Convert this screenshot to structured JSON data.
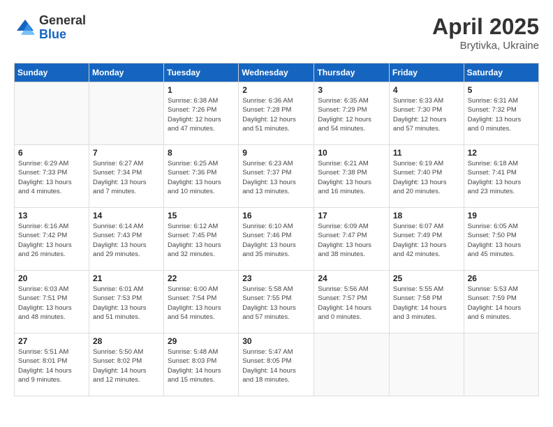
{
  "header": {
    "logo_general": "General",
    "logo_blue": "Blue",
    "title": "April 2025",
    "subtitle": "Brytivka, Ukraine"
  },
  "days_of_week": [
    "Sunday",
    "Monday",
    "Tuesday",
    "Wednesday",
    "Thursday",
    "Friday",
    "Saturday"
  ],
  "weeks": [
    [
      {
        "day": "",
        "info": ""
      },
      {
        "day": "",
        "info": ""
      },
      {
        "day": "1",
        "info": "Sunrise: 6:38 AM\nSunset: 7:26 PM\nDaylight: 12 hours\nand 47 minutes."
      },
      {
        "day": "2",
        "info": "Sunrise: 6:36 AM\nSunset: 7:28 PM\nDaylight: 12 hours\nand 51 minutes."
      },
      {
        "day": "3",
        "info": "Sunrise: 6:35 AM\nSunset: 7:29 PM\nDaylight: 12 hours\nand 54 minutes."
      },
      {
        "day": "4",
        "info": "Sunrise: 6:33 AM\nSunset: 7:30 PM\nDaylight: 12 hours\nand 57 minutes."
      },
      {
        "day": "5",
        "info": "Sunrise: 6:31 AM\nSunset: 7:32 PM\nDaylight: 13 hours\nand 0 minutes."
      }
    ],
    [
      {
        "day": "6",
        "info": "Sunrise: 6:29 AM\nSunset: 7:33 PM\nDaylight: 13 hours\nand 4 minutes."
      },
      {
        "day": "7",
        "info": "Sunrise: 6:27 AM\nSunset: 7:34 PM\nDaylight: 13 hours\nand 7 minutes."
      },
      {
        "day": "8",
        "info": "Sunrise: 6:25 AM\nSunset: 7:36 PM\nDaylight: 13 hours\nand 10 minutes."
      },
      {
        "day": "9",
        "info": "Sunrise: 6:23 AM\nSunset: 7:37 PM\nDaylight: 13 hours\nand 13 minutes."
      },
      {
        "day": "10",
        "info": "Sunrise: 6:21 AM\nSunset: 7:38 PM\nDaylight: 13 hours\nand 16 minutes."
      },
      {
        "day": "11",
        "info": "Sunrise: 6:19 AM\nSunset: 7:40 PM\nDaylight: 13 hours\nand 20 minutes."
      },
      {
        "day": "12",
        "info": "Sunrise: 6:18 AM\nSunset: 7:41 PM\nDaylight: 13 hours\nand 23 minutes."
      }
    ],
    [
      {
        "day": "13",
        "info": "Sunrise: 6:16 AM\nSunset: 7:42 PM\nDaylight: 13 hours\nand 26 minutes."
      },
      {
        "day": "14",
        "info": "Sunrise: 6:14 AM\nSunset: 7:43 PM\nDaylight: 13 hours\nand 29 minutes."
      },
      {
        "day": "15",
        "info": "Sunrise: 6:12 AM\nSunset: 7:45 PM\nDaylight: 13 hours\nand 32 minutes."
      },
      {
        "day": "16",
        "info": "Sunrise: 6:10 AM\nSunset: 7:46 PM\nDaylight: 13 hours\nand 35 minutes."
      },
      {
        "day": "17",
        "info": "Sunrise: 6:09 AM\nSunset: 7:47 PM\nDaylight: 13 hours\nand 38 minutes."
      },
      {
        "day": "18",
        "info": "Sunrise: 6:07 AM\nSunset: 7:49 PM\nDaylight: 13 hours\nand 42 minutes."
      },
      {
        "day": "19",
        "info": "Sunrise: 6:05 AM\nSunset: 7:50 PM\nDaylight: 13 hours\nand 45 minutes."
      }
    ],
    [
      {
        "day": "20",
        "info": "Sunrise: 6:03 AM\nSunset: 7:51 PM\nDaylight: 13 hours\nand 48 minutes."
      },
      {
        "day": "21",
        "info": "Sunrise: 6:01 AM\nSunset: 7:53 PM\nDaylight: 13 hours\nand 51 minutes."
      },
      {
        "day": "22",
        "info": "Sunrise: 6:00 AM\nSunset: 7:54 PM\nDaylight: 13 hours\nand 54 minutes."
      },
      {
        "day": "23",
        "info": "Sunrise: 5:58 AM\nSunset: 7:55 PM\nDaylight: 13 hours\nand 57 minutes."
      },
      {
        "day": "24",
        "info": "Sunrise: 5:56 AM\nSunset: 7:57 PM\nDaylight: 14 hours\nand 0 minutes."
      },
      {
        "day": "25",
        "info": "Sunrise: 5:55 AM\nSunset: 7:58 PM\nDaylight: 14 hours\nand 3 minutes."
      },
      {
        "day": "26",
        "info": "Sunrise: 5:53 AM\nSunset: 7:59 PM\nDaylight: 14 hours\nand 6 minutes."
      }
    ],
    [
      {
        "day": "27",
        "info": "Sunrise: 5:51 AM\nSunset: 8:01 PM\nDaylight: 14 hours\nand 9 minutes."
      },
      {
        "day": "28",
        "info": "Sunrise: 5:50 AM\nSunset: 8:02 PM\nDaylight: 14 hours\nand 12 minutes."
      },
      {
        "day": "29",
        "info": "Sunrise: 5:48 AM\nSunset: 8:03 PM\nDaylight: 14 hours\nand 15 minutes."
      },
      {
        "day": "30",
        "info": "Sunrise: 5:47 AM\nSunset: 8:05 PM\nDaylight: 14 hours\nand 18 minutes."
      },
      {
        "day": "",
        "info": ""
      },
      {
        "day": "",
        "info": ""
      },
      {
        "day": "",
        "info": ""
      }
    ]
  ]
}
